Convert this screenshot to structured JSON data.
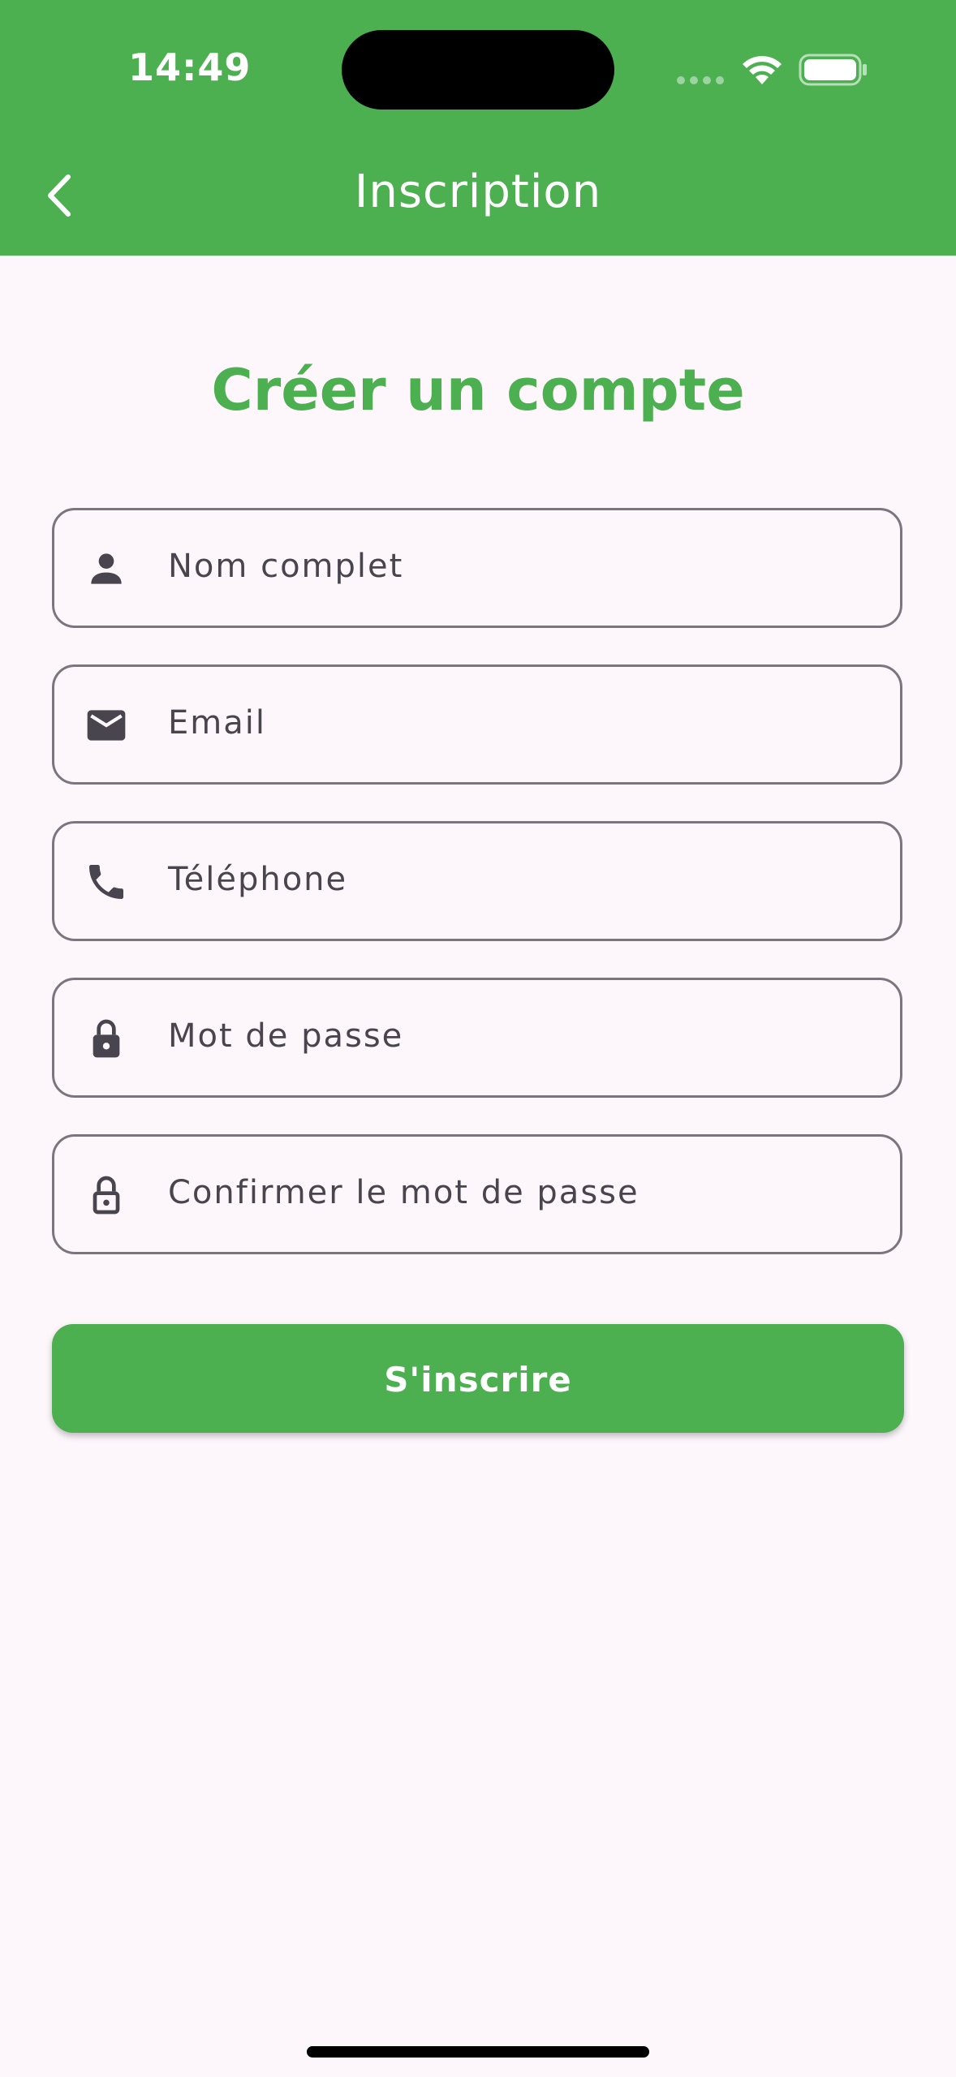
{
  "status_bar": {
    "time": "14:49"
  },
  "app_bar": {
    "title": "Inscription",
    "back_icon": "chevron-left-icon"
  },
  "page": {
    "heading": "Créer un compte"
  },
  "form": {
    "fields": [
      {
        "name": "full-name",
        "icon": "person-icon",
        "placeholder": "Nom complet"
      },
      {
        "name": "email",
        "icon": "mail-icon",
        "placeholder": "Email"
      },
      {
        "name": "phone",
        "icon": "phone-icon",
        "placeholder": "Téléphone"
      },
      {
        "name": "password",
        "icon": "lock-icon",
        "placeholder": "Mot de passe"
      },
      {
        "name": "confirm-password",
        "icon": "lock-outline-icon",
        "placeholder": "Confirmer le mot de passe"
      }
    ],
    "submit_label": "S'inscrire"
  },
  "colors": {
    "primary": "#4caf50",
    "background": "#fdf7fc",
    "field_border": "#7a757f",
    "field_text": "#49454f"
  }
}
